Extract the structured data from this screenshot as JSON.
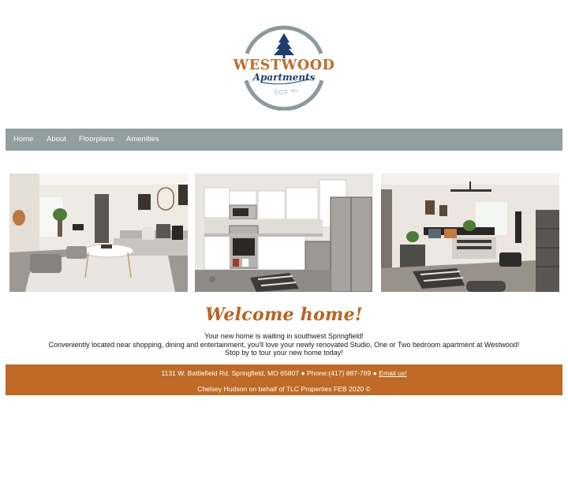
{
  "logo": {
    "name": "WESTWOOD",
    "subtitle": "Apartments",
    "location": "SGF",
    "state": "MO",
    "colors": {
      "ring": "#8d9a9c",
      "name": "#bf6a26",
      "script": "#1f3d6b",
      "tree": "#1f3d6b",
      "location": "#8fc0d6"
    }
  },
  "nav": {
    "items": [
      {
        "label": "Home"
      },
      {
        "label": "About"
      },
      {
        "label": "Floorplans"
      },
      {
        "label": "Amenities"
      }
    ],
    "color": "#929f9e"
  },
  "photos": [
    {
      "subject": "living-room"
    },
    {
      "subject": "kitchen"
    },
    {
      "subject": "bedroom"
    }
  ],
  "welcome": {
    "heading": "Welcome home!",
    "lines": [
      "Your new home is waiting in southwest Springfield!",
      "Conveniently located near shopping, dining and entertainment, you'll love your newly renovated Studio, One or Two bedroom apartment at Westwood!",
      "Stop by to tour your new home today!"
    ],
    "heading_color": "#b8641f"
  },
  "footer": {
    "address_phone": "1131 W. Battlefield Rd, Springfield, MO 65807 ● Phone:(417) 887-789 ●",
    "email_label": "Email us!",
    "credit": "Chelsey Hudson on behalf of TLC Properties FEB 2020 ©",
    "color": "#bf6a26"
  }
}
